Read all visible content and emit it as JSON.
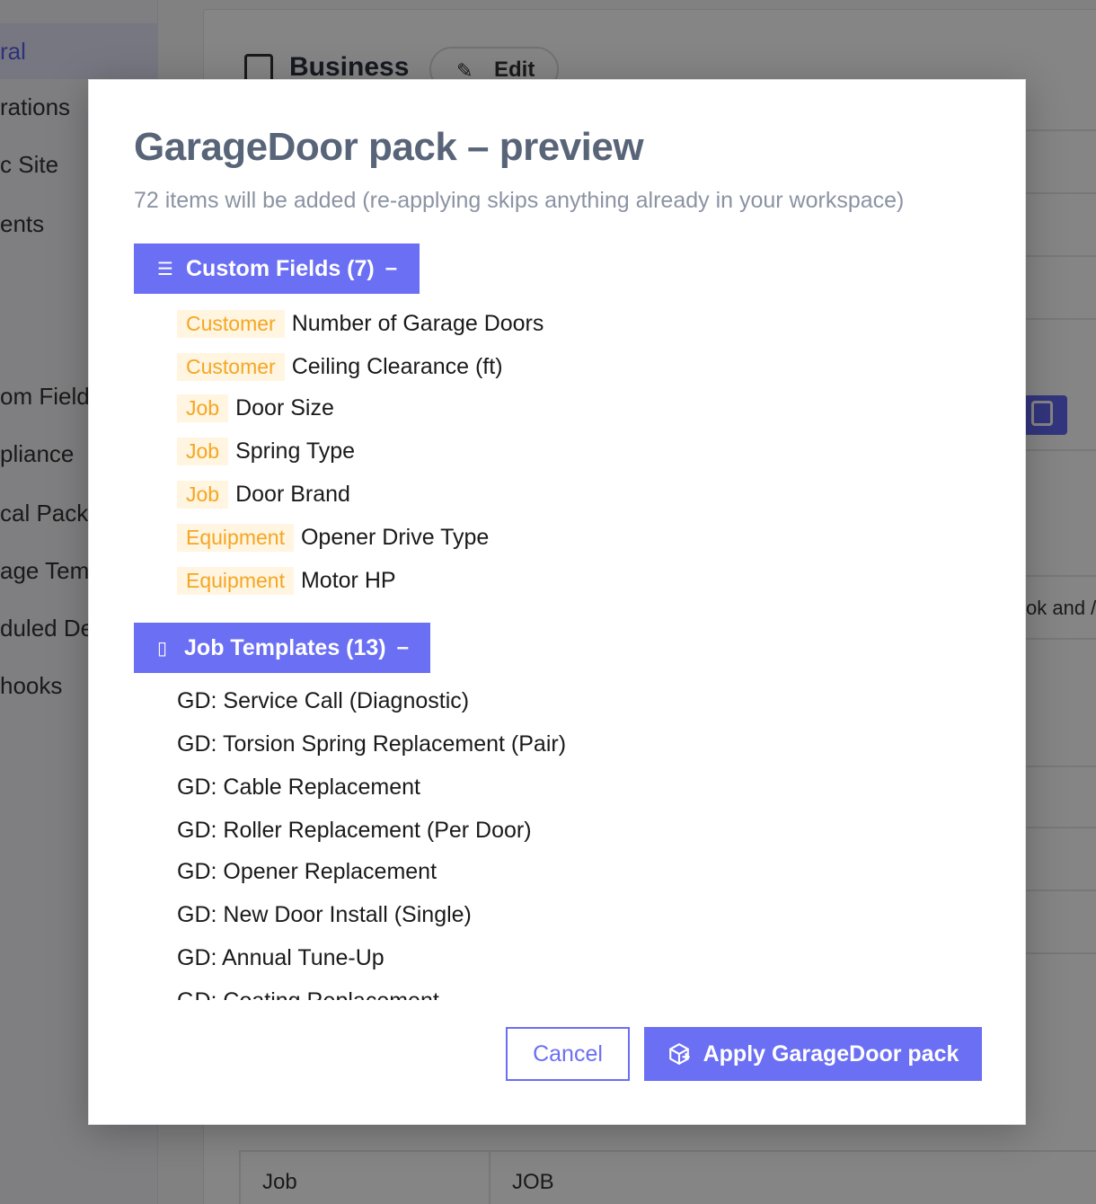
{
  "background": {
    "sidebar_items": [
      "ral",
      "rations",
      "c Site",
      "ents",
      "om Fields",
      "pliance",
      "cal Packs",
      "age Tem",
      "duled De",
      "hooks"
    ],
    "header_title": "Business",
    "edit_label": "Edit",
    "right_snippet": "ok and /",
    "table": {
      "cell1": "Job",
      "cell2": "JOB"
    }
  },
  "modal": {
    "title": "GarageDoor pack – preview",
    "subtitle": "72 items will be added (re-applying skips anything already in your workspace)",
    "custom_fields": {
      "header": "Custom Fields (7)",
      "toggle": "–",
      "items": [
        {
          "tag": "Customer",
          "name": "Number of Garage Doors"
        },
        {
          "tag": "Customer",
          "name": "Ceiling Clearance (ft)"
        },
        {
          "tag": "Job",
          "name": "Door Size"
        },
        {
          "tag": "Job",
          "name": "Spring Type"
        },
        {
          "tag": "Job",
          "name": "Door Brand"
        },
        {
          "tag": "Equipment",
          "name": "Opener Drive Type"
        },
        {
          "tag": "Equipment",
          "name": "Motor HP"
        }
      ]
    },
    "job_templates": {
      "header": "Job Templates (13)",
      "toggle": "–",
      "items": [
        "GD: Service Call (Diagnostic)",
        "GD: Torsion Spring Replacement (Pair)",
        "GD: Cable Replacement",
        "GD: Roller Replacement (Per Door)",
        "GD: Opener Replacement",
        "GD: New Door Install (Single)",
        "GD: Annual Tune-Up",
        "GD: Coating Replacement"
      ]
    },
    "cancel_label": "Cancel",
    "apply_label": "Apply GarageDoor pack"
  },
  "colors": {
    "accent": "#6b6ff4",
    "tag_bg": "#fff5e0",
    "tag_text": "#f5a623",
    "title": "#586478"
  }
}
